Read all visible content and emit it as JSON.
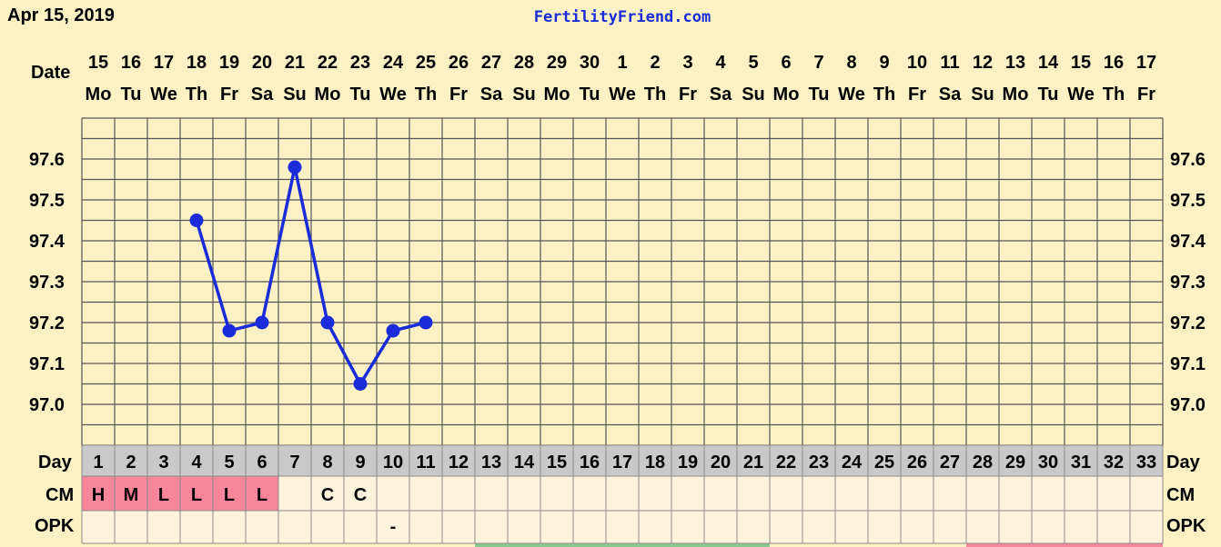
{
  "header": {
    "date": "Apr 15, 2019",
    "site": "FertilityFriend.com"
  },
  "labels": {
    "date_row": "Date",
    "day_row": "Day",
    "cm_row": "CM",
    "opk_row": "OPK"
  },
  "colors": {
    "background": "#fcf1c4",
    "line": "#1a2bd9",
    "grid": "#555555",
    "day_cell": "#c9c9c9",
    "cm_marked": "#f7869a",
    "row_cell": "#fdf3dd",
    "band_green": "#86c98a",
    "band_pink": "#f7869a"
  },
  "chart_data": {
    "type": "line",
    "title": "",
    "xlabel": "Date",
    "ylabel": "",
    "ylim": [
      96.9,
      97.7
    ],
    "yticks": [
      97.0,
      97.1,
      97.2,
      97.3,
      97.4,
      97.5,
      97.6
    ],
    "ytick_labels": [
      "97.0",
      "97.1",
      "97.2",
      "97.3",
      "97.4",
      "97.5",
      "97.6"
    ],
    "dates": [
      "15",
      "16",
      "17",
      "18",
      "19",
      "20",
      "21",
      "22",
      "23",
      "24",
      "25",
      "26",
      "27",
      "28",
      "29",
      "30",
      "1",
      "2",
      "3",
      "4",
      "5",
      "6",
      "7",
      "8",
      "9",
      "10",
      "11",
      "12",
      "13",
      "14",
      "15",
      "16",
      "17"
    ],
    "weekdays": [
      "Mo",
      "Tu",
      "We",
      "Th",
      "Fr",
      "Sa",
      "Su",
      "Mo",
      "Tu",
      "We",
      "Th",
      "Fr",
      "Sa",
      "Su",
      "Mo",
      "Tu",
      "We",
      "Th",
      "Fr",
      "Sa",
      "Su",
      "Mo",
      "Tu",
      "We",
      "Th",
      "Fr",
      "Sa",
      "Su",
      "Mo",
      "Tu",
      "We",
      "Th",
      "Fr"
    ],
    "cycle_days": [
      "1",
      "2",
      "3",
      "4",
      "5",
      "6",
      "7",
      "8",
      "9",
      "10",
      "11",
      "12",
      "13",
      "14",
      "15",
      "16",
      "17",
      "18",
      "19",
      "20",
      "21",
      "22",
      "23",
      "24",
      "25",
      "26",
      "27",
      "28",
      "29",
      "30",
      "31",
      "32",
      "33"
    ],
    "series": [
      {
        "values": [
          null,
          null,
          null,
          97.45,
          97.18,
          97.2,
          97.58,
          97.2,
          97.05,
          97.18,
          97.2
        ]
      }
    ],
    "cm": [
      "H",
      "M",
      "L",
      "L",
      "L",
      "L",
      "",
      "C",
      "C",
      "",
      "",
      "",
      "",
      "",
      "",
      "",
      "",
      "",
      "",
      "",
      "",
      "",
      "",
      "",
      "",
      "",
      "",
      "",
      "",
      "",
      "",
      "",
      ""
    ],
    "cm_marked": [
      true,
      true,
      true,
      true,
      true,
      true,
      false,
      false,
      false,
      false,
      false,
      false,
      false,
      false,
      false,
      false,
      false,
      false,
      false,
      false,
      false,
      false,
      false,
      false,
      false,
      false,
      false,
      false,
      false,
      false,
      false,
      false,
      false
    ],
    "opk": [
      "",
      "",
      "",
      "",
      "",
      "",
      "",
      "",
      "",
      "-",
      "",
      "",
      "",
      "",
      "",
      "",
      "",
      "",
      "",
      "",
      "",
      "",
      "",
      "",
      "",
      "",
      "",
      "",
      "",
      "",
      "",
      "",
      ""
    ],
    "bands": [
      {
        "from_day": 13,
        "to_day": 21,
        "color": "green"
      },
      {
        "from_day": 28,
        "to_day": 33,
        "color": "pink"
      }
    ],
    "grid": true
  }
}
